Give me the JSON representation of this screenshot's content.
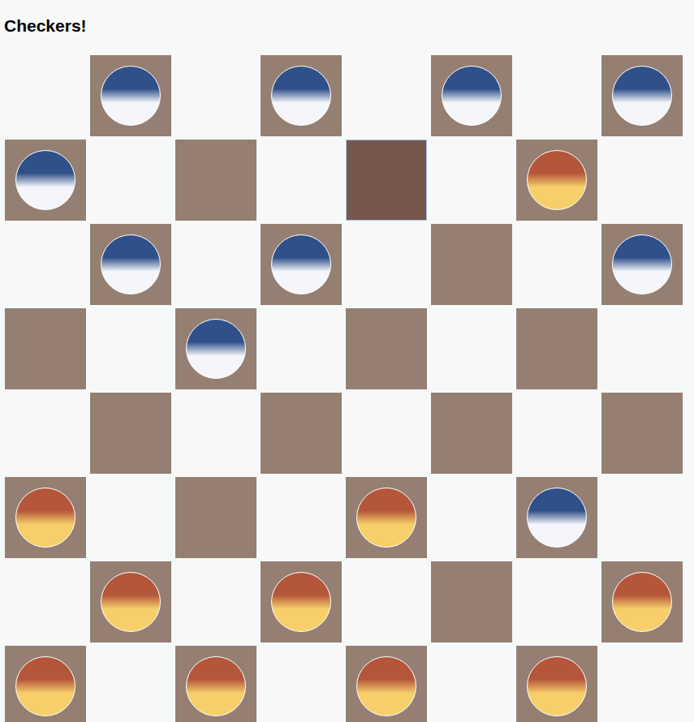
{
  "title": "Checkers!",
  "players": [
    {
      "name": "blue",
      "color": "#2f5089"
    },
    {
      "name": "red",
      "color": "#b4563a"
    }
  ],
  "board": [
    [
      {
        "piece": null,
        "selected": false
      },
      {
        "piece": "blue",
        "selected": false
      },
      {
        "piece": null,
        "selected": false
      },
      {
        "piece": "blue",
        "selected": false
      },
      {
        "piece": null,
        "selected": false
      },
      {
        "piece": "blue",
        "selected": false
      },
      {
        "piece": null,
        "selected": false
      },
      {
        "piece": "blue",
        "selected": false
      }
    ],
    [
      {
        "piece": "blue",
        "selected": false
      },
      {
        "piece": null,
        "selected": false
      },
      {
        "piece": null,
        "selected": false
      },
      {
        "piece": null,
        "selected": false
      },
      {
        "piece": null,
        "selected": true
      },
      {
        "piece": null,
        "selected": false
      },
      {
        "piece": "red",
        "selected": false
      },
      {
        "piece": null,
        "selected": false
      }
    ],
    [
      {
        "piece": null,
        "selected": false
      },
      {
        "piece": "blue",
        "selected": false
      },
      {
        "piece": null,
        "selected": false
      },
      {
        "piece": "blue",
        "selected": false
      },
      {
        "piece": null,
        "selected": false
      },
      {
        "piece": null,
        "selected": false
      },
      {
        "piece": null,
        "selected": false
      },
      {
        "piece": "blue",
        "selected": false
      }
    ],
    [
      {
        "piece": null,
        "selected": false
      },
      {
        "piece": null,
        "selected": false
      },
      {
        "piece": "blue",
        "selected": false
      },
      {
        "piece": null,
        "selected": false
      },
      {
        "piece": null,
        "selected": false
      },
      {
        "piece": null,
        "selected": false
      },
      {
        "piece": null,
        "selected": false
      },
      {
        "piece": null,
        "selected": false
      }
    ],
    [
      {
        "piece": null,
        "selected": false
      },
      {
        "piece": null,
        "selected": false
      },
      {
        "piece": null,
        "selected": false
      },
      {
        "piece": null,
        "selected": false
      },
      {
        "piece": null,
        "selected": false
      },
      {
        "piece": null,
        "selected": false
      },
      {
        "piece": null,
        "selected": false
      },
      {
        "piece": null,
        "selected": false
      }
    ],
    [
      {
        "piece": "red",
        "selected": false
      },
      {
        "piece": null,
        "selected": false
      },
      {
        "piece": null,
        "selected": false
      },
      {
        "piece": null,
        "selected": false
      },
      {
        "piece": "red",
        "selected": false
      },
      {
        "piece": null,
        "selected": false
      },
      {
        "piece": "blue",
        "selected": false
      },
      {
        "piece": null,
        "selected": false
      }
    ],
    [
      {
        "piece": null,
        "selected": false
      },
      {
        "piece": "red",
        "selected": false
      },
      {
        "piece": null,
        "selected": false
      },
      {
        "piece": "red",
        "selected": false
      },
      {
        "piece": null,
        "selected": false
      },
      {
        "piece": null,
        "selected": false
      },
      {
        "piece": null,
        "selected": false
      },
      {
        "piece": "red",
        "selected": false
      }
    ],
    [
      {
        "piece": "red",
        "selected": false
      },
      {
        "piece": null,
        "selected": false
      },
      {
        "piece": "red",
        "selected": false
      },
      {
        "piece": null,
        "selected": false
      },
      {
        "piece": "red",
        "selected": false
      },
      {
        "piece": null,
        "selected": false
      },
      {
        "piece": "red",
        "selected": false
      },
      {
        "piece": null,
        "selected": false
      }
    ]
  ]
}
